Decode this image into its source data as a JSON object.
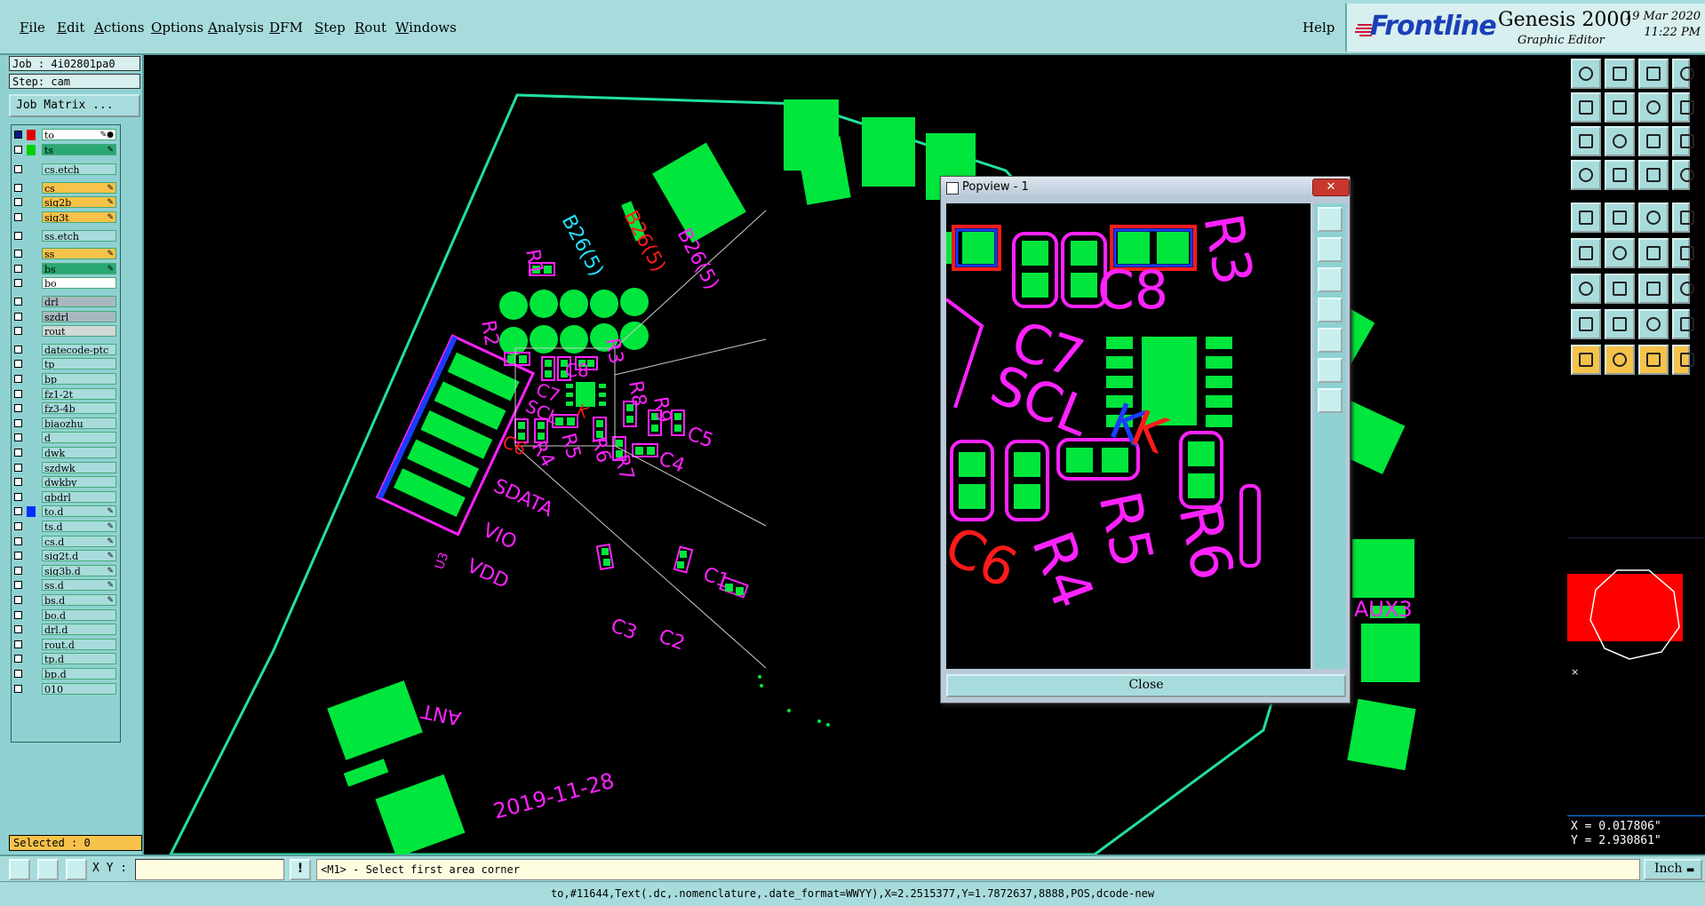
{
  "menubar": {
    "items": [
      {
        "label": "File",
        "underline": "F",
        "rest": "ile"
      },
      {
        "label": "Edit",
        "underline": "E",
        "rest": "dit"
      },
      {
        "label": "Actions",
        "underline": "A",
        "rest": "ctions"
      },
      {
        "label": "Options",
        "underline": "O",
        "rest": "ptions"
      },
      {
        "label": "Analysis",
        "underline": "A",
        "rest": "nalysis"
      },
      {
        "label": "DFM",
        "underline": "D",
        "rest": "FM"
      },
      {
        "label": "Step",
        "underline": "S",
        "rest": "tep"
      },
      {
        "label": "Rout",
        "underline": "R",
        "rest": "out"
      },
      {
        "label": "Windows",
        "underline": "W",
        "rest": "indows"
      }
    ],
    "help": "Help"
  },
  "brand": {
    "logo_text": "Frontline",
    "product": "Genesis 2000",
    "subtitle": "Graphic Editor",
    "date": "19 Mar 2020",
    "time": "11:22 PM",
    "accent": "#1b3fb8"
  },
  "left": {
    "job": "Job : 4i02801pa0",
    "step": "Step: cam",
    "job_matrix": "Job Matrix ...",
    "selected": "Selected : 0",
    "layers": [
      {
        "name": "to",
        "bg": "#ffffff",
        "swatch": "#e00000",
        "checked": true,
        "edit": "✎●"
      },
      {
        "name": "ts",
        "bg": "#2aa874",
        "swatch": "#00d000",
        "checked": false,
        "edit": "✎"
      },
      {
        "name": "cs.etch",
        "bg": "#a8dcdc",
        "swatch": "",
        "checked": false,
        "edit": ""
      },
      {
        "name": "cs",
        "bg": "#f7c24a",
        "swatch": "",
        "checked": false,
        "edit": "✎"
      },
      {
        "name": "sig2b",
        "bg": "#f7c24a",
        "swatch": "",
        "checked": false,
        "edit": "✎"
      },
      {
        "name": "sig3t",
        "bg": "#f7c24a",
        "swatch": "",
        "checked": false,
        "edit": "✎"
      },
      {
        "name": "ss.etch",
        "bg": "#a8dcdc",
        "swatch": "",
        "checked": false,
        "edit": ""
      },
      {
        "name": "ss",
        "bg": "#f7c24a",
        "swatch": "",
        "checked": false,
        "edit": "✎"
      },
      {
        "name": "bs",
        "bg": "#2aa874",
        "swatch": "",
        "checked": false,
        "edit": "✎"
      },
      {
        "name": "bo",
        "bg": "#ffffff",
        "swatch": "",
        "checked": false,
        "edit": ""
      },
      {
        "name": "drl",
        "bg": "#a8b8c0",
        "swatch": "",
        "checked": false,
        "edit": ""
      },
      {
        "name": "szdrl",
        "bg": "#a8b8c0",
        "swatch": "",
        "checked": false,
        "edit": ""
      },
      {
        "name": "rout",
        "bg": "#d0d8d8",
        "swatch": "",
        "checked": false,
        "edit": ""
      },
      {
        "name": "datecode-ptc",
        "bg": "#a8dcdc",
        "swatch": "",
        "checked": false,
        "edit": ""
      },
      {
        "name": "tp",
        "bg": "#a8dcdc",
        "swatch": "",
        "checked": false,
        "edit": ""
      },
      {
        "name": "bp",
        "bg": "#a8dcdc",
        "swatch": "",
        "checked": false,
        "edit": ""
      },
      {
        "name": "fz1-2t",
        "bg": "#a8dcdc",
        "swatch": "",
        "checked": false,
        "edit": ""
      },
      {
        "name": "fz3-4b",
        "bg": "#a8dcdc",
        "swatch": "",
        "checked": false,
        "edit": ""
      },
      {
        "name": "biaozhu",
        "bg": "#a8dcdc",
        "swatch": "",
        "checked": false,
        "edit": ""
      },
      {
        "name": "d",
        "bg": "#a8dcdc",
        "swatch": "",
        "checked": false,
        "edit": ""
      },
      {
        "name": "dwk",
        "bg": "#a8dcdc",
        "swatch": "",
        "checked": false,
        "edit": ""
      },
      {
        "name": "szdwk",
        "bg": "#a8dcdc",
        "swatch": "",
        "checked": false,
        "edit": ""
      },
      {
        "name": "dwkby",
        "bg": "#a8dcdc",
        "swatch": "",
        "checked": false,
        "edit": ""
      },
      {
        "name": "gbdrl",
        "bg": "#a8dcdc",
        "swatch": "",
        "checked": false,
        "edit": ""
      },
      {
        "name": "to.d",
        "bg": "#a8dcdc",
        "swatch": "#0030ff",
        "checked": false,
        "edit": "✎"
      },
      {
        "name": "ts.d",
        "bg": "#a8dcdc",
        "swatch": "",
        "checked": false,
        "edit": "✎"
      },
      {
        "name": "cs.d",
        "bg": "#a8dcdc",
        "swatch": "",
        "checked": false,
        "edit": "✎"
      },
      {
        "name": "sig2t.d",
        "bg": "#a8dcdc",
        "swatch": "",
        "checked": false,
        "edit": "✎"
      },
      {
        "name": "sig3b.d",
        "bg": "#a8dcdc",
        "swatch": "",
        "checked": false,
        "edit": "✎"
      },
      {
        "name": "ss.d",
        "bg": "#a8dcdc",
        "swatch": "",
        "checked": false,
        "edit": "✎"
      },
      {
        "name": "bs.d",
        "bg": "#a8dcdc",
        "swatch": "",
        "checked": false,
        "edit": "✎"
      },
      {
        "name": "bo.d",
        "bg": "#a8dcdc",
        "swatch": "",
        "checked": false,
        "edit": ""
      },
      {
        "name": "drl.d",
        "bg": "#a8dcdc",
        "swatch": "",
        "checked": false,
        "edit": ""
      },
      {
        "name": "rout.d",
        "bg": "#a8dcdc",
        "swatch": "",
        "checked": false,
        "edit": ""
      },
      {
        "name": "tp.d",
        "bg": "#a8dcdc",
        "swatch": "",
        "checked": false,
        "edit": ""
      },
      {
        "name": "bp.d",
        "bg": "#a8dcdc",
        "swatch": "",
        "checked": false,
        "edit": ""
      },
      {
        "name": "010",
        "bg": "#a8dcdc",
        "swatch": "",
        "checked": false,
        "edit": ""
      }
    ]
  },
  "canvas": {
    "board_labels": {
      "r1": "R1",
      "b26_5a": "B26(5)",
      "b26_5b": "B26(5)",
      "b26_5c": "B26(5)",
      "r2": "R2",
      "r3": "R3",
      "r8": "R8",
      "r9": "R9",
      "c5": "C5",
      "c4": "C4",
      "c6": "C6",
      "c7": "C7",
      "c8": "C8",
      "scl": "SCL",
      "k": "K",
      "r4": "R4",
      "r5": "R5",
      "r6": "R6",
      "r7": "R7",
      "sdata": "SDATA",
      "vio": "VIO",
      "vdd": "VDD",
      "u3": "U3",
      "c1": "C1",
      "c2": "C2",
      "c3": "C3",
      "ant": "ANT",
      "datecode": "2019-11-28",
      "aux3": "AUX3"
    },
    "colors": {
      "board": "#00e63c",
      "outline": "#22e0a0",
      "silk": "#ff22ff",
      "red": "#ff1a1a",
      "blue": "#1a3cff"
    }
  },
  "popview": {
    "title": "Popview - 1",
    "close_x": "✕",
    "close": "Close",
    "labels": {
      "r3": "R3",
      "c8": "C8",
      "c7": "C7",
      "scl": "SCL",
      "k1": "K",
      "k2": "K",
      "c6": "C6",
      "r4": "R4",
      "r5": "R5",
      "r6": "R6"
    }
  },
  "coords": {
    "x": "X = 0.017806\"",
    "y": "Y = 2.930861\""
  },
  "statusbar": {
    "xy_label": "X Y :",
    "xy_value": "",
    "info": "!",
    "message": "<M1> - Select first area corner",
    "unit": "Inch"
  },
  "bottom": {
    "text": "to,#11644,Text(.dc,.nomenclature,.date_format=WWYY),X=2.2515377,Y=1.7872637,8888,POS,dcode-new"
  }
}
